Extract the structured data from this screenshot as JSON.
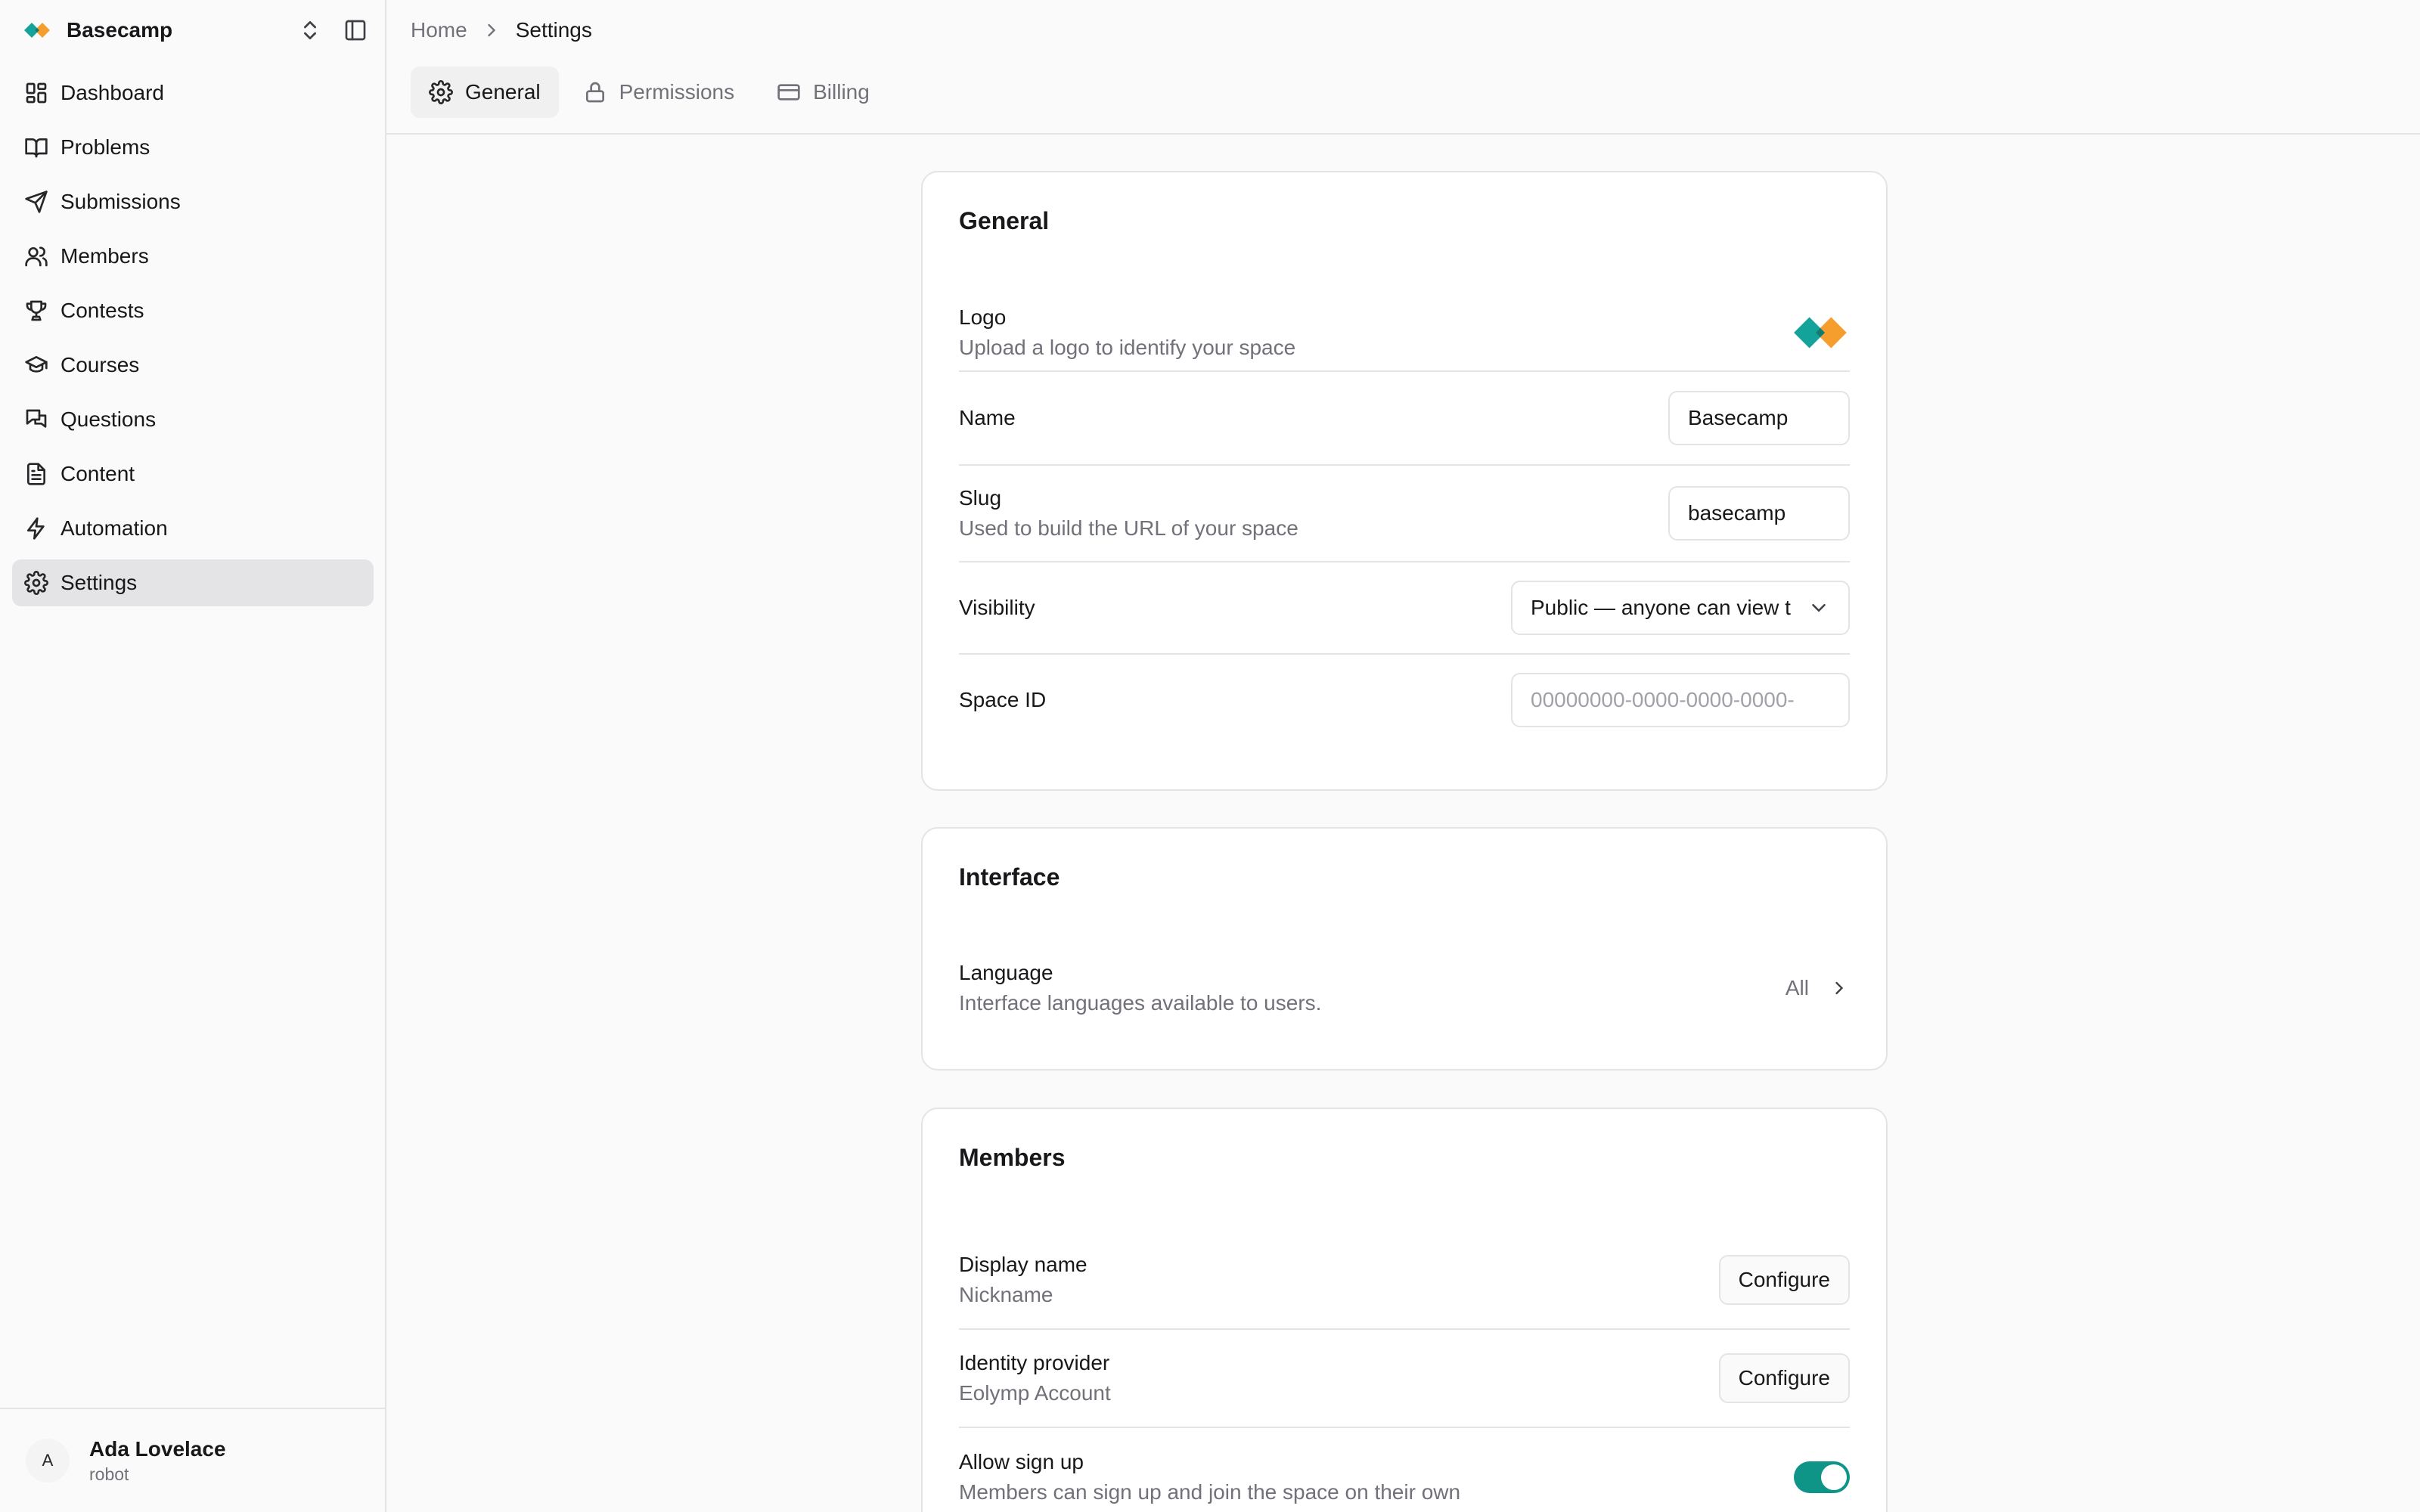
{
  "workspace": {
    "name": "Basecamp"
  },
  "sidebar": {
    "items": [
      {
        "label": "Dashboard",
        "icon": "dashboard-icon"
      },
      {
        "label": "Problems",
        "icon": "book-icon"
      },
      {
        "label": "Submissions",
        "icon": "send-icon"
      },
      {
        "label": "Members",
        "icon": "users-icon"
      },
      {
        "label": "Contests",
        "icon": "trophy-icon"
      },
      {
        "label": "Courses",
        "icon": "graduation-cap-icon"
      },
      {
        "label": "Questions",
        "icon": "chat-icon"
      },
      {
        "label": "Content",
        "icon": "document-icon"
      },
      {
        "label": "Automation",
        "icon": "lightning-icon"
      },
      {
        "label": "Settings",
        "icon": "gear-icon",
        "active": true
      }
    ]
  },
  "user": {
    "initial": "A",
    "name": "Ada Lovelace",
    "subtitle": "robot"
  },
  "breadcrumb": {
    "home": "Home",
    "current": "Settings"
  },
  "tabs": [
    {
      "label": "General",
      "icon": "gear-icon",
      "active": true
    },
    {
      "label": "Permissions",
      "icon": "lock-icon"
    },
    {
      "label": "Billing",
      "icon": "credit-card-icon"
    }
  ],
  "general": {
    "title": "General",
    "logo": {
      "label": "Logo",
      "desc": "Upload a logo to identify your space"
    },
    "name": {
      "label": "Name",
      "value": "Basecamp"
    },
    "slug": {
      "label": "Slug",
      "desc": "Used to build the URL of your space",
      "value": "basecamp"
    },
    "visibility": {
      "label": "Visibility",
      "value": "Public — anyone can view t"
    },
    "space_id": {
      "label": "Space ID",
      "placeholder": "00000000-0000-0000-0000-"
    }
  },
  "interface": {
    "title": "Interface",
    "language": {
      "label": "Language",
      "desc": "Interface languages available to users.",
      "value": "All"
    }
  },
  "members": {
    "title": "Members",
    "display_name": {
      "label": "Display name",
      "desc": "Nickname",
      "button": "Configure"
    },
    "identity_provider": {
      "label": "Identity provider",
      "desc": "Eolymp Account",
      "button": "Configure"
    },
    "allow_signup": {
      "label": "Allow sign up",
      "desc": "Members can sign up and join the space on their own",
      "enabled": true
    }
  },
  "colors": {
    "accent": "#0f9488",
    "logo_teal": "#14a39a",
    "logo_orange": "#f59e2e"
  }
}
